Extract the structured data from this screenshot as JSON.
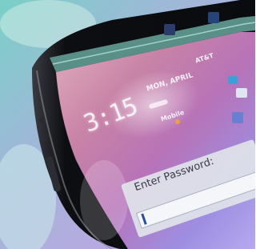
{
  "lock_screen": {
    "clock": "3:15",
    "date": "MON, APRIL",
    "carrier": "AT&T",
    "network": "Mobile",
    "password_prompt": "Enter Password:",
    "password_value": ""
  },
  "colors": {
    "phone_frame": "#15161a",
    "status_bar": "#5a8f88",
    "dialog_bg": "#dfe3ea",
    "cursor": "#2a4fa0"
  }
}
